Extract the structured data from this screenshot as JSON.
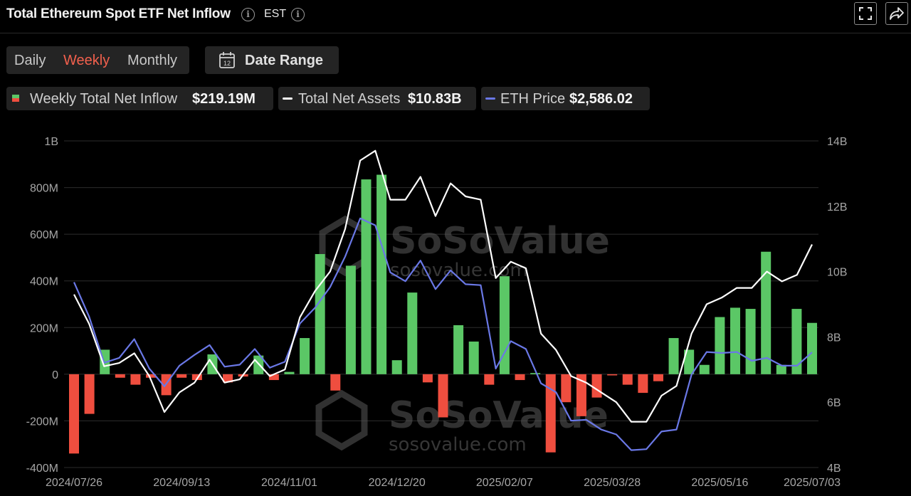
{
  "header": {
    "title": "Total Ethereum Spot ETF Net Inflow",
    "timezone": "EST"
  },
  "controls": {
    "periods": [
      "Daily",
      "Weekly",
      "Monthly"
    ],
    "active_period": "Weekly",
    "date_range_label": "Date Range",
    "calendar_day": "12"
  },
  "legend": {
    "inflow_label": "Weekly Total Net Inflow",
    "inflow_value": "$219.19M",
    "assets_label": "Total Net Assets",
    "assets_value": "$10.83B",
    "price_label": "ETH Price",
    "price_value": "$2,586.02"
  },
  "watermark": {
    "brand": "SoSoValue",
    "url": "sosovalue.com"
  },
  "colors": {
    "positive": "#5bc766",
    "negative": "#ef4e3f",
    "assets_line": "#ffffff",
    "price_line": "#6a78e6",
    "active": "#f2604d"
  },
  "chart_data": {
    "type": "bar",
    "x_tick_labels": [
      "2024/07/26",
      "2024/09/13",
      "2024/11/01",
      "2024/12/20",
      "2025/02/07",
      "2025/03/28",
      "2025/05/16",
      "2025/07/03"
    ],
    "left_axis": {
      "ylim": [
        -400000000,
        1000000000
      ],
      "ticks": [
        "-400M",
        "-200M",
        "0",
        "200M",
        "400M",
        "600M",
        "800M",
        "1B"
      ]
    },
    "right_axis": {
      "ylim": [
        4000000000,
        14000000000
      ],
      "ticks": [
        "4B",
        "6B",
        "8B",
        "10B",
        "12B",
        "14B"
      ]
    },
    "series": [
      {
        "name": "Weekly Total Net Inflow",
        "kind": "bar",
        "axis": "left",
        "values": [
          -340,
          -170,
          105,
          -15,
          -45,
          -15,
          -90,
          -15,
          -25,
          85,
          -35,
          -10,
          80,
          -25,
          10,
          155,
          515,
          -70,
          465,
          835,
          855,
          60,
          350,
          -35,
          -185,
          210,
          140,
          -45,
          420,
          -25,
          5,
          -335,
          -120,
          -180,
          -100,
          -5,
          -45,
          -80,
          -30,
          155,
          105,
          40,
          245,
          285,
          280,
          525,
          40,
          280,
          220
        ]
      },
      {
        "name": "Total Net Assets",
        "kind": "line",
        "axis": "right",
        "values": [
          9.3,
          8.4,
          7.1,
          7.2,
          7.5,
          6.8,
          5.7,
          6.3,
          6.6,
          7.3,
          6.6,
          6.7,
          7.3,
          6.8,
          7.0,
          8.6,
          9.4,
          10.0,
          11.3,
          13.4,
          13.7,
          12.2,
          12.2,
          12.9,
          11.7,
          12.7,
          12.3,
          12.2,
          9.8,
          10.3,
          10.1,
          8.1,
          7.6,
          6.8,
          6.6,
          6.3,
          6.0,
          5.4,
          5.4,
          6.2,
          6.5,
          8.1,
          9.0,
          9.2,
          9.5,
          9.5,
          10.0,
          9.7,
          9.9,
          10.83
        ]
      },
      {
        "name": "ETH Price",
        "kind": "line",
        "axis": "price",
        "values": [
          3300,
          2950,
          2480,
          2530,
          2720,
          2420,
          2240,
          2450,
          2560,
          2660,
          2440,
          2460,
          2620,
          2430,
          2490,
          2880,
          3040,
          3250,
          3560,
          3950,
          3880,
          3400,
          3310,
          3520,
          3230,
          3420,
          3280,
          3270,
          2420,
          2700,
          2620,
          2270,
          2180,
          1890,
          1900,
          1800,
          1750,
          1590,
          1600,
          1780,
          1800,
          2360,
          2590,
          2580,
          2590,
          2500,
          2530,
          2450,
          2450,
          2586.02
        ]
      }
    ]
  }
}
